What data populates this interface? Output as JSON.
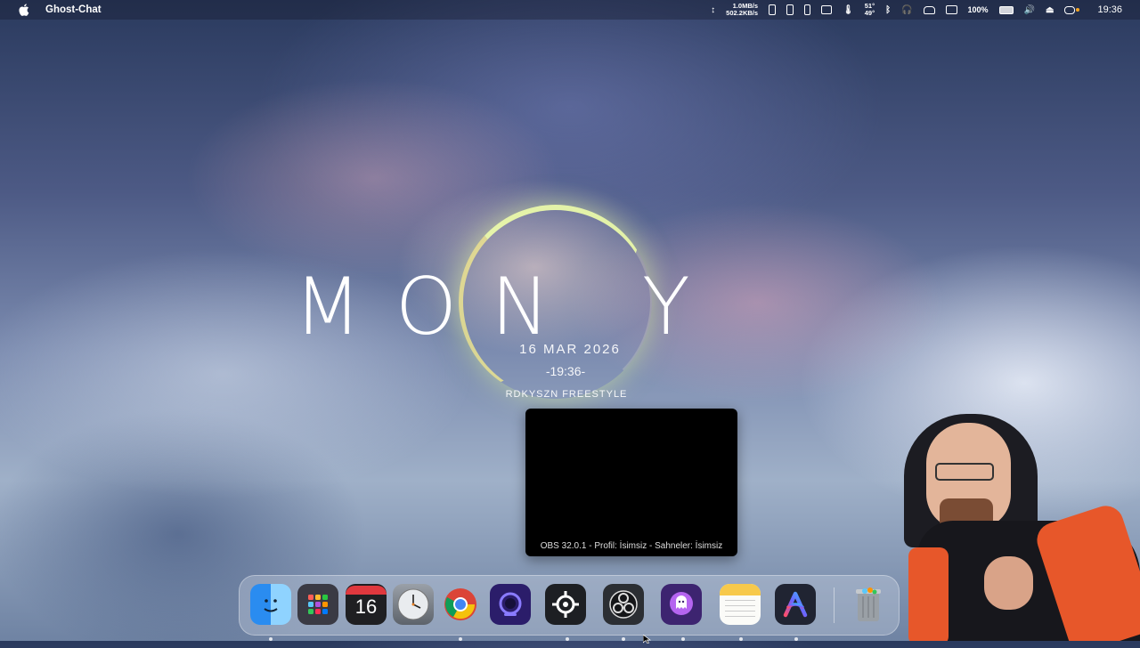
{
  "menubar": {
    "app_name": "Ghost-Chat",
    "net_up": "1.0MB/s",
    "net_down": "502.2KB/s",
    "temp_high": "51°",
    "temp_low": "49°",
    "battery": "100%",
    "clock": "19:36"
  },
  "widget": {
    "brand_text": "MON  Y",
    "date": "16 MAR 2026",
    "time": "-19:36-",
    "subtitle": "RDKYSZN FREESTYLE"
  },
  "obs": {
    "caption": "OBS 32.0.1 - Profil: İsimsiz - Sahneler: İsimsiz"
  },
  "dock": {
    "calendar_day": "16",
    "items": [
      "finder",
      "launchpad",
      "calendar",
      "clock",
      "chrome",
      "obs-alt",
      "steelseries",
      "obs",
      "ghost-chat",
      "notes",
      "arc",
      "trash"
    ]
  }
}
